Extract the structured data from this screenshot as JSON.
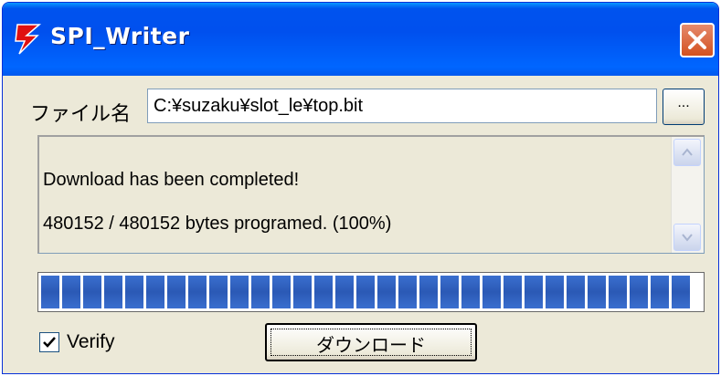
{
  "window": {
    "title": "SPI_Writer",
    "close_icon": "close-x-icon",
    "app_icon": "red-lightning-icon"
  },
  "file": {
    "label": "ファイル名",
    "value": "C:¥suzaku¥slot_le¥top.bit",
    "browse_label": "..."
  },
  "log": {
    "lines": [
      "Download has been completed!",
      "480152 / 480152 bytes programed. (100%)"
    ]
  },
  "progress": {
    "percent": 100
  },
  "verify": {
    "label": "Verify",
    "checked": true
  },
  "download": {
    "label": "ダウンロード"
  },
  "colors": {
    "titlebar": "#0053ee",
    "progress_block": "#2b59b5",
    "close_button": "#d4511f",
    "window_bg": "#ece9d8"
  }
}
